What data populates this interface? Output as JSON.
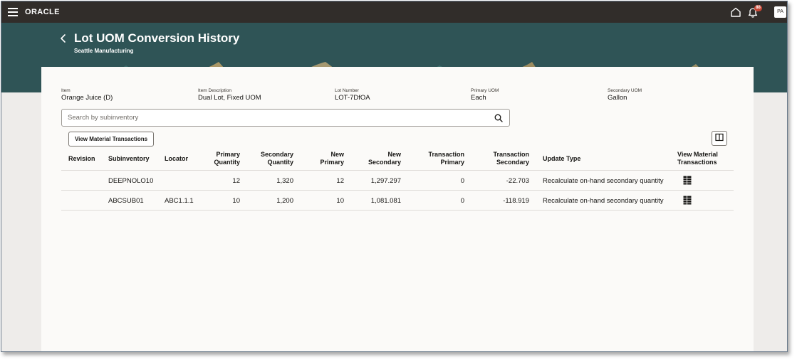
{
  "topbar": {
    "logo": "ORACLE",
    "notification_count": "88",
    "avatar_initials": "PA"
  },
  "page": {
    "title": "Lot UOM Conversion History",
    "subtitle": "Seattle Manufacturing"
  },
  "attributes": [
    {
      "label": "Item",
      "value": "Orange Juice (D)"
    },
    {
      "label": "Item Description",
      "value": "Dual Lot, Fixed UOM"
    },
    {
      "label": "Lot Number",
      "value": "LOT-7DfOA"
    },
    {
      "label": "Primary UOM",
      "value": "Each"
    },
    {
      "label": "Secondary UOM",
      "value": "Gallon"
    }
  ],
  "search": {
    "placeholder": "Search by subinventory",
    "value": ""
  },
  "toolbar": {
    "view_material_transactions_label": "View Material Transactions"
  },
  "table": {
    "headers": {
      "revision": "Revision",
      "subinventory": "Subinventory",
      "locator": "Locator",
      "primary_quantity": [
        "Primary",
        "Quantity"
      ],
      "secondary_quantity": [
        "Secondary",
        "Quantity"
      ],
      "new_primary": [
        "New",
        "Primary"
      ],
      "new_secondary": [
        "New",
        "Secondary"
      ],
      "transaction_primary": [
        "Transaction",
        "Primary"
      ],
      "transaction_secondary": [
        "Transaction",
        "Secondary"
      ],
      "update_type": "Update Type",
      "view_material_transactions": [
        "View Material",
        "Transactions"
      ]
    },
    "rows": [
      {
        "revision": "",
        "subinventory": "DEEPNOLO10",
        "locator": "",
        "primary_quantity": "12",
        "secondary_quantity": "1,320",
        "new_primary": "12",
        "new_secondary": "1,297.297",
        "transaction_primary": "0",
        "transaction_secondary": "-22.703",
        "update_type": "Recalculate on-hand secondary quantity"
      },
      {
        "revision": "",
        "subinventory": "ABCSUB01",
        "locator": "ABC1.1.1",
        "primary_quantity": "10",
        "secondary_quantity": "1,200",
        "new_primary": "10",
        "new_secondary": "1,081.081",
        "transaction_primary": "0",
        "transaction_secondary": "-118.919",
        "update_type": "Recalculate on-hand secondary quantity"
      }
    ]
  },
  "colors": {
    "topbar": "#312d2a",
    "banner": "#2f5456",
    "notification_badge": "#c74634"
  }
}
